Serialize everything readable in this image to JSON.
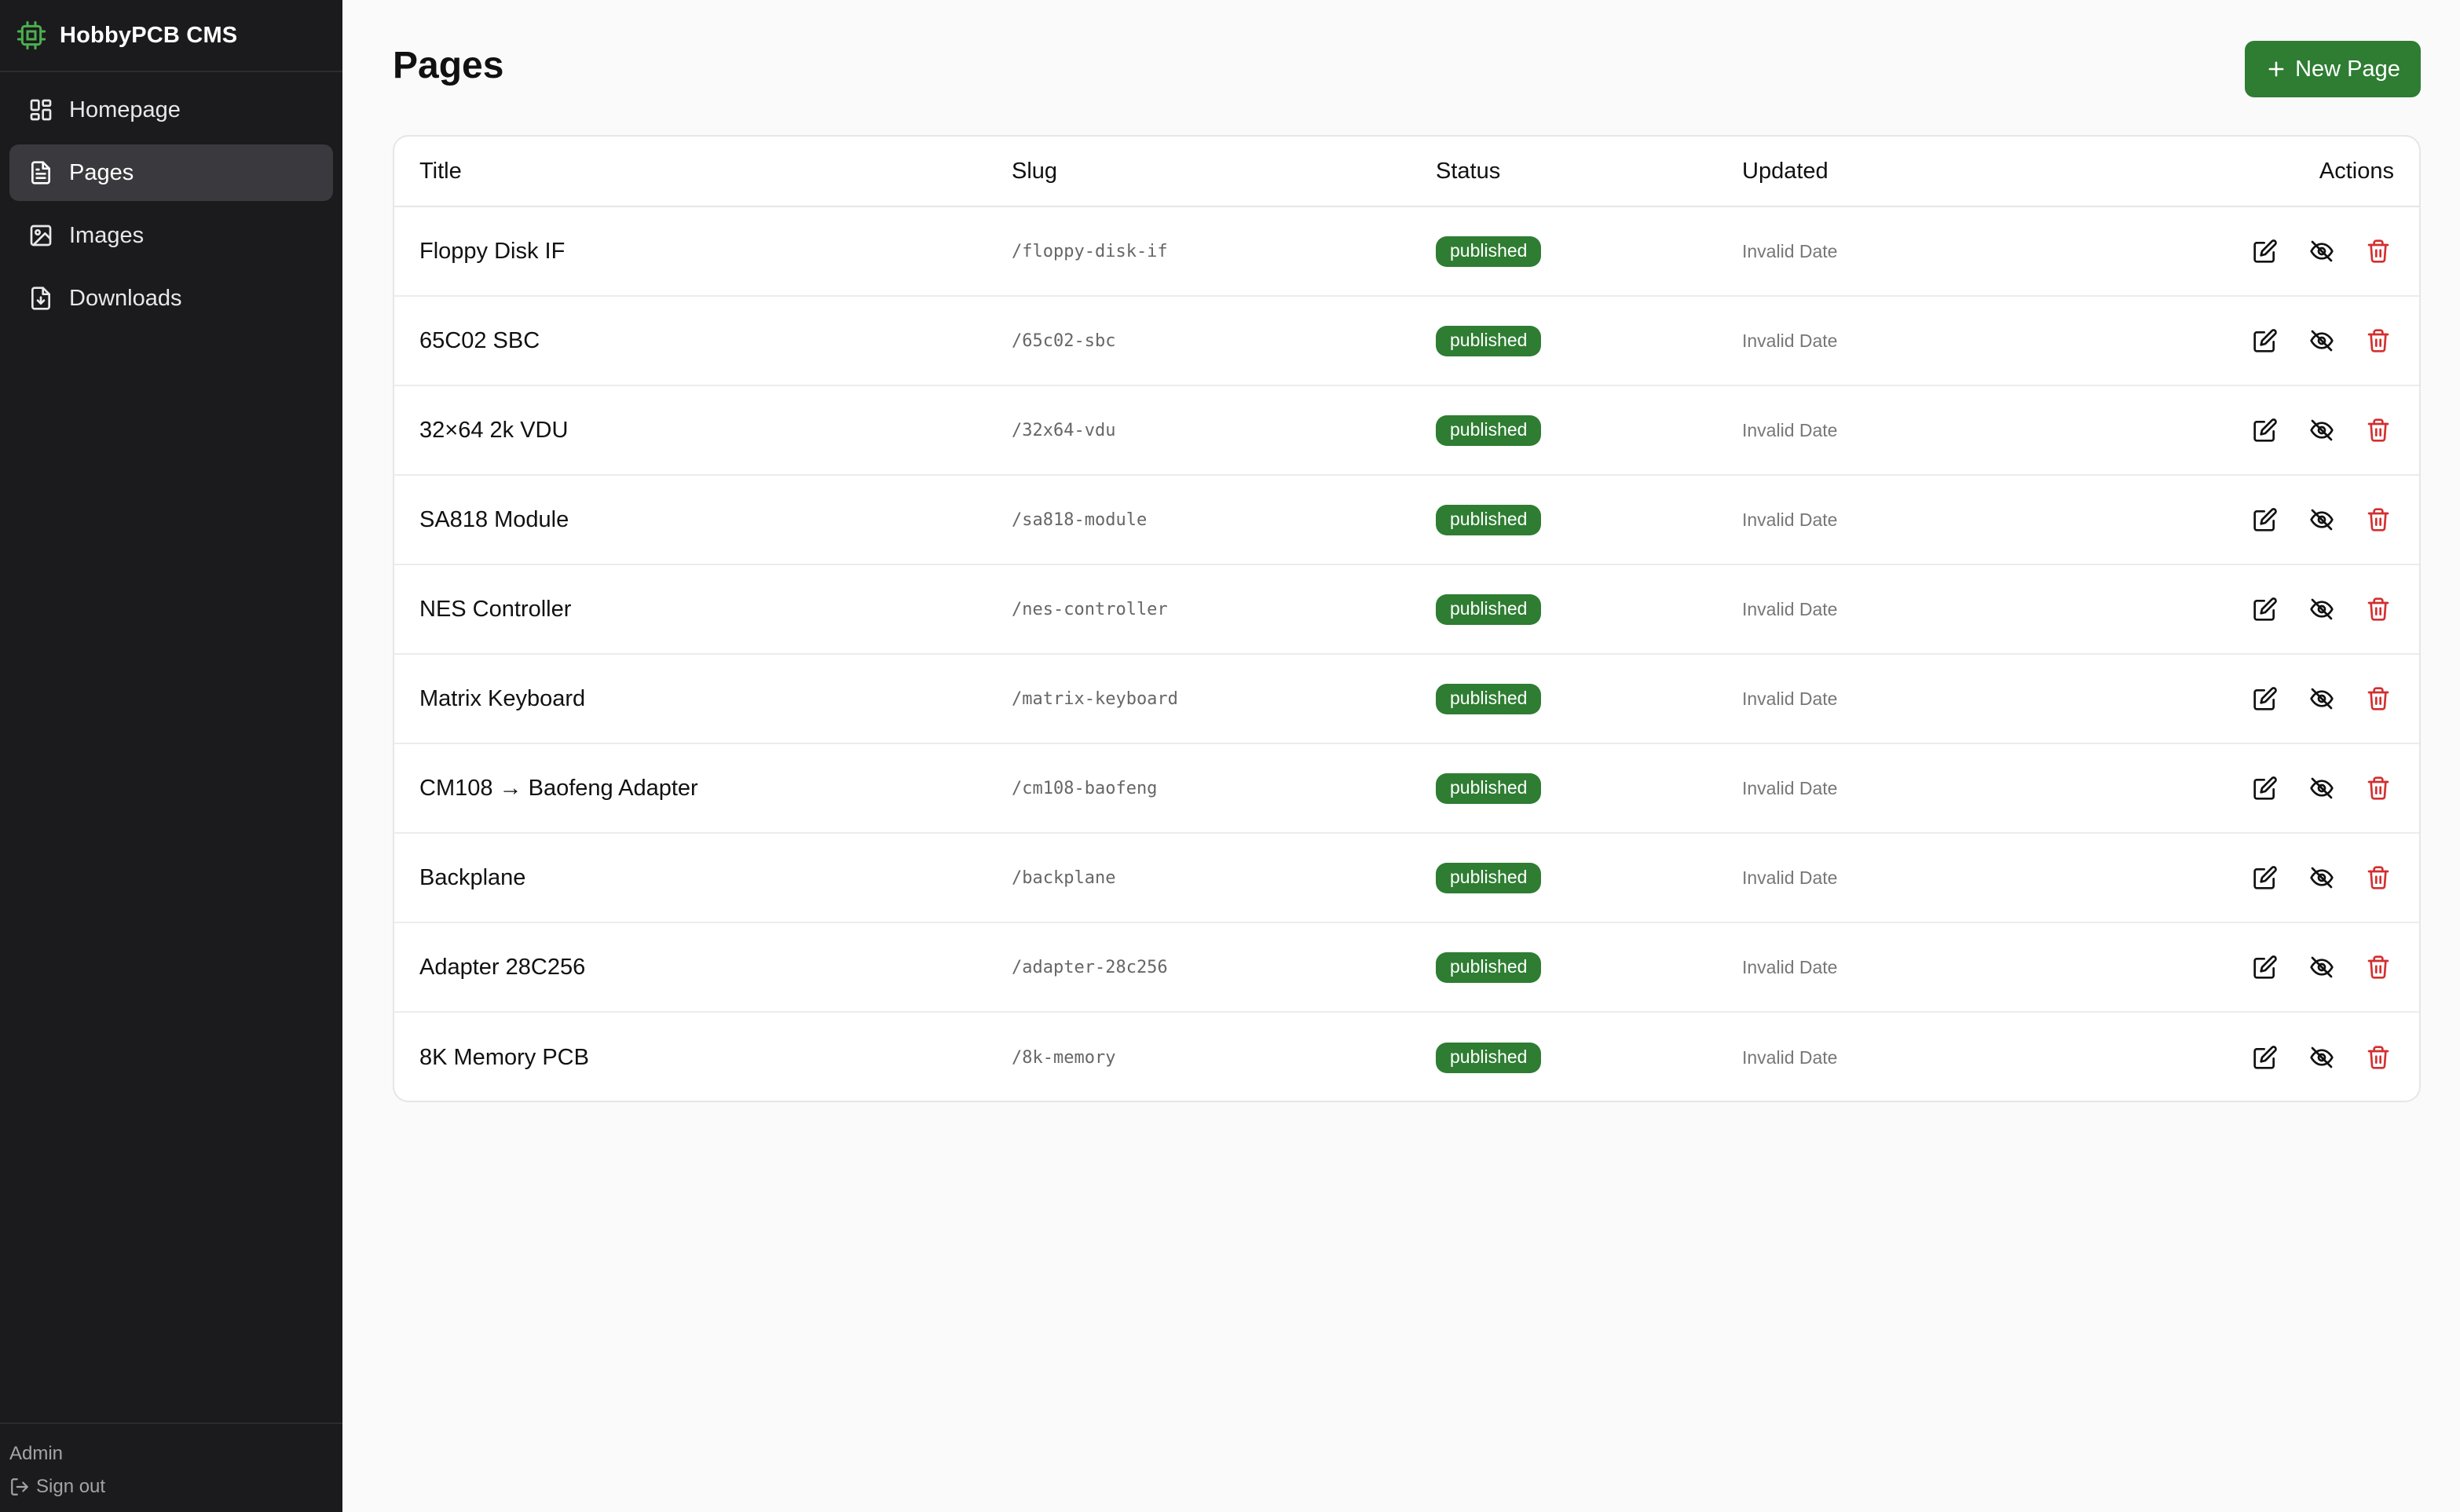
{
  "app": {
    "title": "HobbyPCB CMS"
  },
  "sidebar": {
    "items": [
      {
        "label": "Homepage",
        "icon": "layout-dashboard-icon"
      },
      {
        "label": "Pages",
        "icon": "file-text-icon",
        "active": true
      },
      {
        "label": "Images",
        "icon": "image-icon"
      },
      {
        "label": "Downloads",
        "icon": "file-download-icon"
      }
    ],
    "footer": {
      "user": "Admin",
      "signout": "Sign out"
    }
  },
  "main": {
    "title": "Pages",
    "new_button": "New Page",
    "table": {
      "headers": {
        "title": "Title",
        "slug": "Slug",
        "status": "Status",
        "updated": "Updated",
        "actions": "Actions"
      },
      "rows": [
        {
          "title": "Floppy Disk IF",
          "slug": "/floppy-disk-if",
          "status": "published",
          "updated": "Invalid Date"
        },
        {
          "title": "65C02 SBC",
          "slug": "/65c02-sbc",
          "status": "published",
          "updated": "Invalid Date"
        },
        {
          "title": "32×64 2k VDU",
          "slug": "/32x64-vdu",
          "status": "published",
          "updated": "Invalid Date"
        },
        {
          "title": "SA818 Module",
          "slug": "/sa818-module",
          "status": "published",
          "updated": "Invalid Date"
        },
        {
          "title": "NES Controller",
          "slug": "/nes-controller",
          "status": "published",
          "updated": "Invalid Date"
        },
        {
          "title": "Matrix Keyboard",
          "slug": "/matrix-keyboard",
          "status": "published",
          "updated": "Invalid Date"
        },
        {
          "title": "CM108 → Baofeng Adapter",
          "slug": "/cm108-baofeng",
          "status": "published",
          "updated": "Invalid Date"
        },
        {
          "title": "Backplane",
          "slug": "/backplane",
          "status": "published",
          "updated": "Invalid Date"
        },
        {
          "title": "Adapter 28C256",
          "slug": "/adapter-28c256",
          "status": "published",
          "updated": "Invalid Date"
        },
        {
          "title": "8K Memory PCB",
          "slug": "/8k-memory",
          "status": "published",
          "updated": "Invalid Date"
        }
      ]
    }
  },
  "colors": {
    "sidebar_bg": "#1b1b1d",
    "accent": "#2e7d32",
    "brand_icon": "#4caf50",
    "delete": "#d32f2f"
  }
}
